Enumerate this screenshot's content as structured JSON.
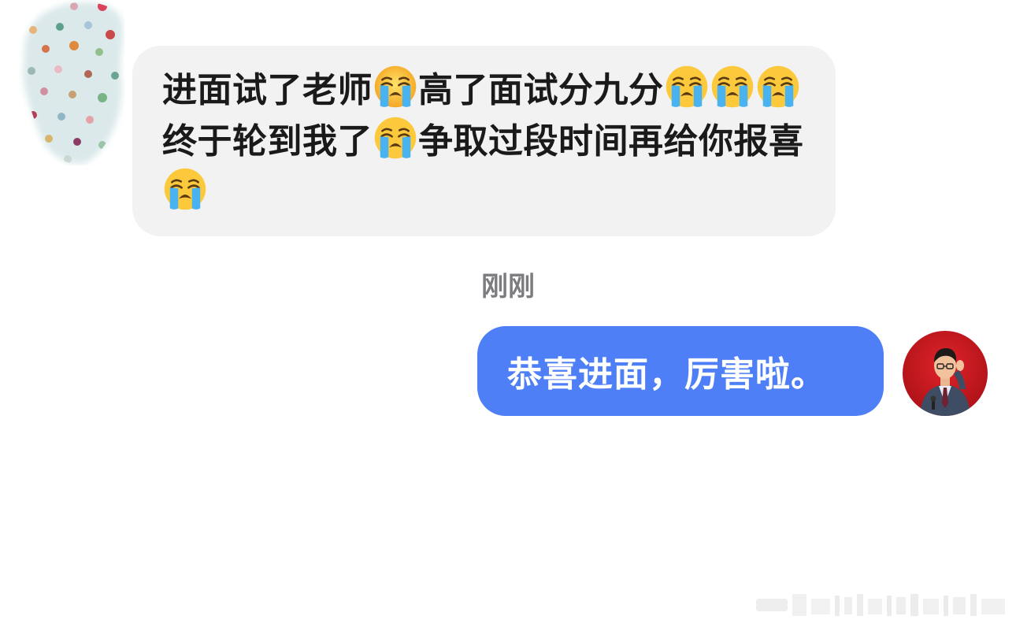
{
  "incoming_message": {
    "segments": [
      {
        "type": "text",
        "value": "进面试了老师"
      },
      {
        "type": "emoji",
        "icon": "loudly-crying-face-emoji"
      },
      {
        "type": "text",
        "value": "高了面试分九分"
      },
      {
        "type": "emoji",
        "icon": "loudly-crying-face-emoji"
      },
      {
        "type": "emoji",
        "icon": "loudly-crying-face-emoji"
      },
      {
        "type": "emoji",
        "icon": "loudly-crying-face-emoji"
      },
      {
        "type": "text",
        "value": "终于轮到我了"
      },
      {
        "type": "emoji",
        "icon": "loudly-crying-face-emoji"
      },
      {
        "type": "text",
        "value": "争取过段时间再给你报喜"
      },
      {
        "type": "emoji",
        "icon": "loudly-crying-face-emoji"
      }
    ]
  },
  "timestamp": "刚刚",
  "outgoing_message": {
    "text": "恭喜进面，厉害啦。"
  },
  "colors": {
    "incoming_bubble": "#f2f2f3",
    "outgoing_bubble": "#4f7ff7",
    "timestamp_text": "#7b7b80",
    "avatar_right_bg": "#c8161d"
  }
}
